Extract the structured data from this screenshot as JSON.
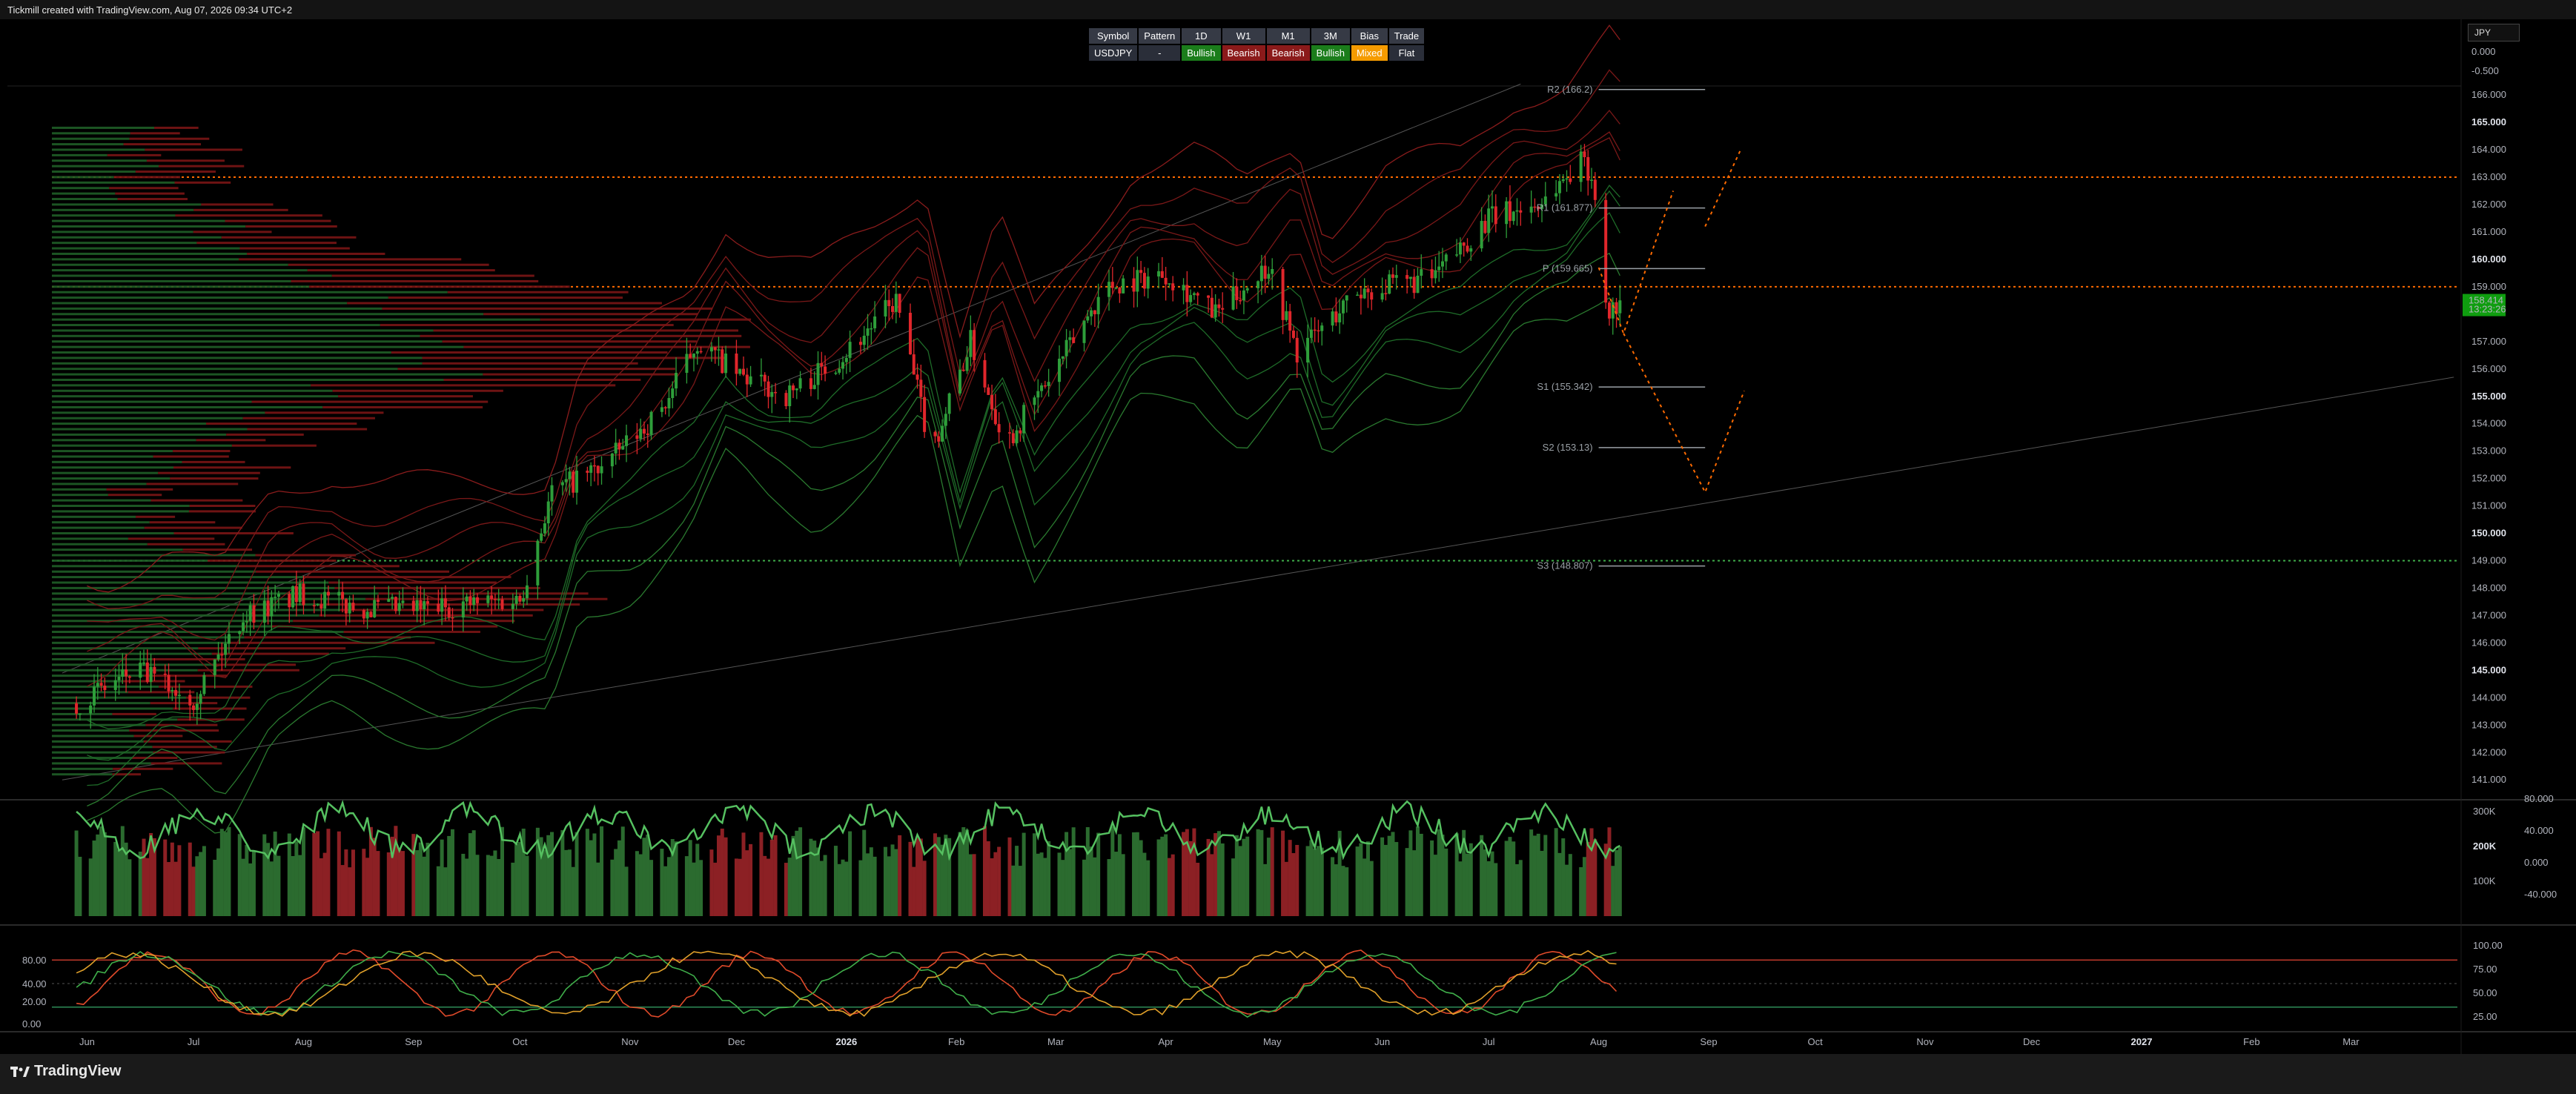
{
  "header_text": "Tickmill created with TradingView.com, Aug 07, 2026 09:34 UTC+2",
  "brand": "TradingView",
  "currency_button": "JPY",
  "indicator_table": {
    "headers": [
      "Symbol",
      "Pattern",
      "1D",
      "W1",
      "M1",
      "3M",
      "Bias",
      "Trade"
    ],
    "values": [
      "USDJPY",
      "-",
      "Bullish",
      "Bearish",
      "Bearish",
      "Bullish",
      "Mixed",
      "Flat"
    ],
    "value_colors": [
      "#2a2e39",
      "#2a2e39",
      "#1b7d1b",
      "#8b1a1a",
      "#8b1a1a",
      "#1b7d1b",
      "#f59b00",
      "#2a2e39"
    ]
  },
  "colors": {
    "bull": "#2e9e3a",
    "bear": "#e0262b",
    "pivot_line": "#ff6a00",
    "price_badge": "#0f9d0f"
  },
  "chart_data": [
    {
      "type": "candlestick",
      "symbol": "USDJPY",
      "x_ticks": [
        "Jun",
        "Jul",
        "Aug",
        "Sep",
        "Oct",
        "Nov",
        "Dec",
        "2026",
        "Feb",
        "Mar",
        "Apr",
        "May",
        "Jun",
        "Jul",
        "Aug",
        "Sep",
        "Oct",
        "Nov",
        "Dec",
        "2027",
        "Feb",
        "Mar"
      ],
      "bold_x_ticks": [
        "2026",
        "2027"
      ],
      "y_ticks": [
        "166.000",
        "165.000",
        "164.000",
        "163.000",
        "162.000",
        "161.000",
        "160.000",
        "159.000",
        "157.000",
        "156.000",
        "155.000",
        "154.000",
        "153.000",
        "152.000",
        "151.000",
        "150.000",
        "149.000",
        "148.000",
        "147.000",
        "146.000",
        "145.000",
        "144.000",
        "143.000",
        "142.000",
        "141.000"
      ],
      "bold_y_ticks": [
        "165.000",
        "160.000",
        "155.000",
        "150.000",
        "145.000"
      ],
      "ylim": [
        140.6,
        166.6
      ],
      "last_price": "158.414",
      "countdown": "13:23:26",
      "price_path": [
        [
          "2025-05-29",
          143.8
        ],
        [
          "2025-06-15",
          145.0
        ],
        [
          "2025-07-01",
          144.0
        ],
        [
          "2025-07-15",
          147.0
        ],
        [
          "2025-08-01",
          147.8
        ],
        [
          "2025-08-15",
          147.3
        ],
        [
          "2025-09-01",
          147.2
        ],
        [
          "2025-09-15",
          147.4
        ],
        [
          "2025-10-01",
          147.6
        ],
        [
          "2025-10-10",
          151.5
        ],
        [
          "2025-10-25",
          152.5
        ],
        [
          "2025-11-10",
          154.5
        ],
        [
          "2025-11-20",
          157.0
        ],
        [
          "2025-12-01",
          155.8
        ],
        [
          "2025-12-15",
          155.0
        ],
        [
          "2025-12-31",
          156.5
        ],
        [
          "2026-01-15",
          158.5
        ],
        [
          "2026-01-25",
          153.0
        ],
        [
          "2026-02-05",
          157.0
        ],
        [
          "2026-02-15",
          153.3
        ],
        [
          "2026-03-01",
          156.0
        ],
        [
          "2026-03-15",
          159.0
        ],
        [
          "2026-04-01",
          159.5
        ],
        [
          "2026-04-15",
          158.0
        ],
        [
          "2026-04-30",
          159.8
        ],
        [
          "2026-05-08",
          156.6
        ],
        [
          "2026-05-25",
          158.8
        ],
        [
          "2026-06-15",
          159.3
        ],
        [
          "2026-07-01",
          161.5
        ],
        [
          "2026-07-15",
          162.0
        ],
        [
          "2026-07-28",
          163.7
        ],
        [
          "2026-08-01",
          162.2
        ],
        [
          "2026-08-03",
          158.0
        ],
        [
          "2026-08-07",
          158.4
        ]
      ],
      "pivot_levels": [
        {
          "label": "R2 (166.2)",
          "value": 166.2
        },
        {
          "label": "R1 (161.877)",
          "value": 161.877
        },
        {
          "label": "P (159.665)",
          "value": 159.665
        },
        {
          "label": "S1 (155.342)",
          "value": 155.342
        },
        {
          "label": "S2 (153.13)",
          "value": 153.13
        },
        {
          "label": "S3 (148.807)",
          "value": 148.807
        }
      ],
      "horizontal_dotted_lines": [
        {
          "value": 163.0,
          "color": "orange"
        },
        {
          "value": 159.0,
          "color": "orange"
        },
        {
          "value": 149.0,
          "color": "green"
        }
      ],
      "projection_paths": [
        [
          [
            "2026-08-01",
            159.7
          ],
          [
            "2026-08-08",
            157.3
          ],
          [
            "2026-08-22",
            162.5
          ]
        ],
        [
          [
            "2026-08-08",
            157.3
          ],
          [
            "2026-08-31",
            151.5
          ],
          [
            "2026-09-11",
            155.2
          ]
        ],
        [
          [
            "2026-08-31",
            161.2
          ],
          [
            "2026-09-10",
            164.0
          ]
        ]
      ]
    },
    {
      "type": "volume",
      "y_ticks": [
        "300K",
        "200K",
        "100K"
      ],
      "bold_y_ticks": [
        "200K"
      ],
      "oscillator_ticks": [
        "80.000",
        "40.000",
        "0.000",
        "-40.000"
      ]
    },
    {
      "type": "line",
      "left_ticks": [
        "80.00",
        "40.00",
        "20.00",
        "0.00"
      ],
      "right_ticks": [
        "100.00",
        "75.00",
        "50.00",
        "25.00"
      ]
    }
  ],
  "top_right_ticks": [
    "0.000",
    "-0.500"
  ]
}
